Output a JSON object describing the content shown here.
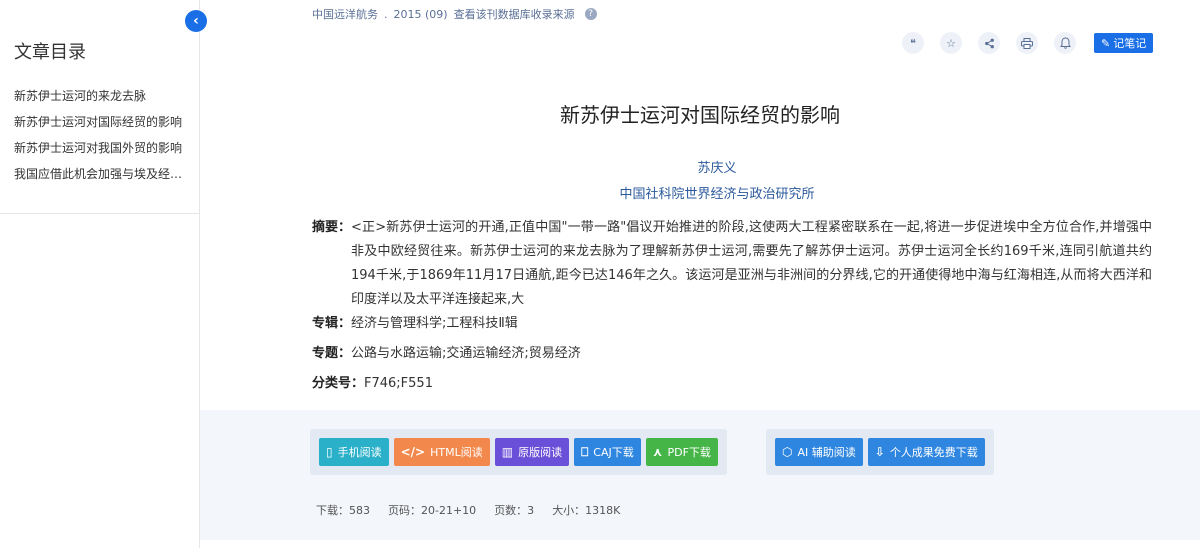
{
  "sidebar": {
    "title": "文章目录",
    "items": [
      {
        "label": "新苏伊士运河的来龙去脉"
      },
      {
        "label": "新苏伊士运河对国际经贸的影响"
      },
      {
        "label": "新苏伊士运河对我国外贸的影响"
      },
      {
        "label": "我国应借此机会加强与埃及经贸..."
      }
    ],
    "collapse_icon": "chevron-left-icon"
  },
  "source": {
    "journal": "中国远洋航务",
    "issue": "2015 (09)",
    "db_link": "查看该刊数据库收录来源",
    "help_icon": "?"
  },
  "toolbar": {
    "icons": [
      "quote-icon",
      "star-icon",
      "share-icon",
      "print-icon",
      "bell-icon"
    ],
    "note_label": "记笔记"
  },
  "article": {
    "title": "新苏伊士运河对国际经贸的影响",
    "author": "苏庆义",
    "organization": "中国社科院世界经济与政治研究所",
    "abstract_label": "摘要：",
    "abstract": "<正>新苏伊士运河的开通,正值中国\"一带一路\"倡议开始推进的阶段,这使两大工程紧密联系在一起,将进一步促进埃中全方位合作,并增强中非及中欧经贸往来。新苏伊士运河的来龙去脉为了理解新苏伊士运河,需要先了解苏伊士运河。苏伊士运河全长约169千米,连同引航道共约194千米,于1869年11月17日通航,距今已达146年之久。该运河是亚洲与非洲间的分界线,它的开通使得地中海与红海相连,从而将大西洋和印度洋以及太平洋连接起来,大",
    "series_label": "专辑：",
    "series": "经济与管理科学;工程科技Ⅱ辑",
    "topic_label": "专题：",
    "topic": "公路与水路运输;交通运输经济;贸易经济",
    "class_label": "分类号：",
    "class_no": "F746;F551"
  },
  "actions": {
    "group1": [
      {
        "label": "手机阅读",
        "icon": "phone-icon"
      },
      {
        "label": "HTML阅读",
        "icon": "code-icon"
      },
      {
        "label": "原版阅读",
        "icon": "book-icon"
      },
      {
        "label": "CAJ下载",
        "icon": "open-book-icon"
      },
      {
        "label": "PDF下载",
        "icon": "pdf-icon"
      }
    ],
    "group2": [
      {
        "label": "AI 辅助阅读",
        "icon": "ai-icon"
      },
      {
        "label": "个人成果免费下载",
        "icon": "download-icon"
      }
    ]
  },
  "stats": {
    "downloads": "下载：583",
    "pages_range": "页码：20-21+10",
    "page_count": "页数：3",
    "size": "大小：1318K"
  }
}
